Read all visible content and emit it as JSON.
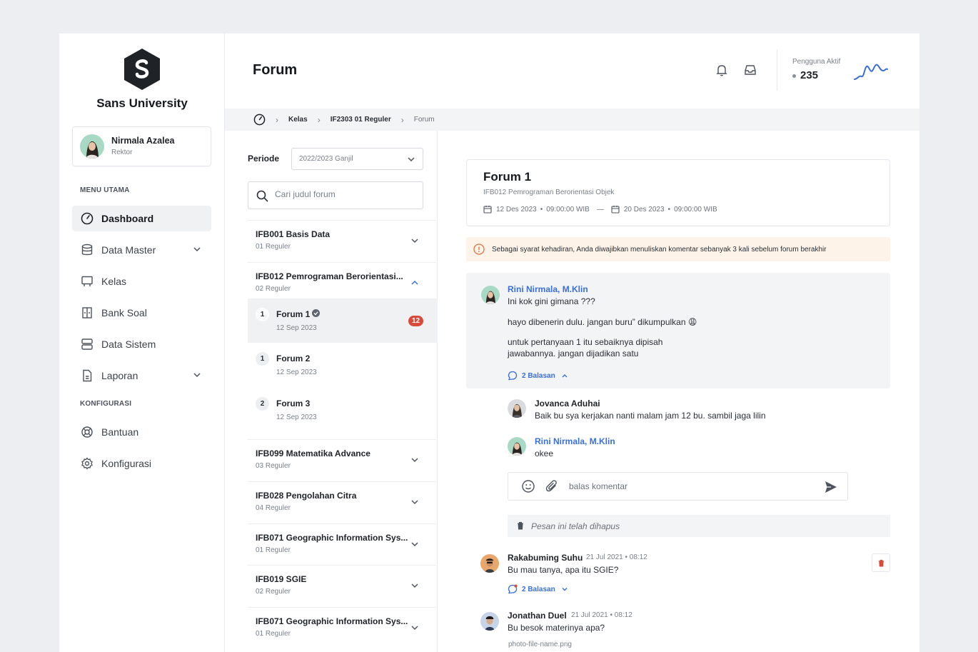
{
  "app": {
    "name": "Sans University",
    "logo_icon": "s-hexagon-logo"
  },
  "user": {
    "name": "Nirmala Azalea",
    "role": "Rektor"
  },
  "sidebar": {
    "section_main": "MENU UTAMA",
    "section_config": "KONFIGURASI",
    "items": [
      {
        "label": "Dashboard",
        "icon": "gauge-icon",
        "active": true
      },
      {
        "label": "Data Master",
        "icon": "database-icon",
        "expandable": true
      },
      {
        "label": "Kelas",
        "icon": "easel-icon"
      },
      {
        "label": "Bank Soal",
        "icon": "book-icon"
      },
      {
        "label": "Data Sistem",
        "icon": "server-icon"
      },
      {
        "label": "Laporan",
        "icon": "document-icon",
        "expandable": true
      },
      {
        "label": "Bantuan",
        "icon": "lifebuoy-icon"
      },
      {
        "label": "Konfigurasi",
        "icon": "gear-icon"
      }
    ]
  },
  "header": {
    "title": "Forum",
    "active_users_label": "Pengguna Aktif",
    "active_users_count": "235",
    "accent": "#3a6fd8"
  },
  "breadcrumb": {
    "items": [
      "Kelas",
      "IF2303 01 Reguler"
    ],
    "current": "Forum"
  },
  "filter": {
    "periode_label": "Periode",
    "periode_value": "2022/2023 Ganjil",
    "search_placeholder": "Cari judul forum"
  },
  "courses": [
    {
      "title": "IFB001 Basis Data",
      "sub": "01 Reguler",
      "expanded": false
    },
    {
      "title": "IFB012 Pemrograman Berorientasi...",
      "sub": "02 Reguler",
      "expanded": true
    },
    {
      "title": "IFB099 Matematika Advance",
      "sub": "03 Reguler",
      "expanded": false
    },
    {
      "title": "IFB028 Pengolahan Citra",
      "sub": "04 Reguler",
      "expanded": false
    },
    {
      "title": "IFB071 Geographic Information Sys...",
      "sub": "01 Reguler",
      "expanded": false
    },
    {
      "title": "IFB019 SGIE",
      "sub": "02 Reguler",
      "expanded": false
    },
    {
      "title": "IFB071 Geographic Information Sys...",
      "sub": "01 Reguler",
      "expanded": false
    }
  ],
  "forums": [
    {
      "num": "1",
      "title": "Forum 1",
      "date": "12 Sep 2023",
      "badge": "12",
      "verified": true,
      "active": true
    },
    {
      "num": "1",
      "title": "Forum 2",
      "date": "12 Sep 2023"
    },
    {
      "num": "2",
      "title": "Forum 3",
      "date": "12 Sep 2023"
    }
  ],
  "forum_detail": {
    "title": "Forum 1",
    "course": "IFB012 Pemrograman Berorientasi Objek",
    "start_date": "12 Des 2023",
    "start_time": "09:00:00 WIB",
    "end_date": "20 Des 2023",
    "end_time": "09:00:00 WIB",
    "notice": "Sebagai syarat kehadiran, Anda diwajibkan menuliskan komentar sebanyak 3 kali sebelum forum berakhir"
  },
  "comments": {
    "c1_author": "Rini Nirmala, M.Klin",
    "c1_line1": "Ini kok gini gimana ???",
    "c1_line2": "hayo dibenerin dulu. jangan buru” dikumpulkan 😩",
    "c1_line3": "untuk pertanyaan 1 itu sebaiknya dipisah",
    "c1_line4": "jawabannya. jangan dijadikan satu",
    "c1_replies": "2 Balasan",
    "r1_author": "Jovanca Aduhai",
    "r1_text": "Baik bu sya kerjakan nanti malam jam 12 bu. sambil jaga lilin",
    "r2_author": "Rini Nirmala, M.Klin",
    "r2_text": "okee",
    "reply_placeholder": "balas komentar",
    "deleted_text": "Pesan ini telah dihapus",
    "c2_author": "Rakabuming Suhu",
    "c2_meta": "21 Jul 2021 • 08:12",
    "c2_text": "Bu mau tanya, apa itu SGIE?",
    "c2_replies": "2 Balasan",
    "c3_author": "Jonathan Duel",
    "c3_meta": "21 Jul 2021 • 08:12",
    "c3_text": "Bu besok materinya apa?",
    "c3_file": "photo-file-name.png"
  }
}
